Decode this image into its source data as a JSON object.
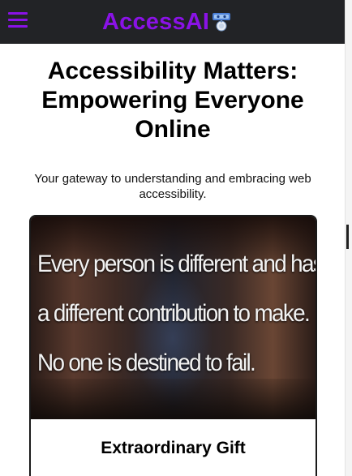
{
  "header": {
    "menu_icon": "hamburger-menu-icon",
    "brand_name": "AccessAI",
    "brand_icon": "robot-icon",
    "accent_color": "#8a12e6",
    "background_color": "#222326"
  },
  "main": {
    "title": "Accessibility Matters: Empowering Everyone Online",
    "subtitle": "Your gateway to understanding and embracing web accessibility."
  },
  "card": {
    "image_quote_lines": [
      "Every person is different and has",
      "a different contribution to make.",
      "No one is destined to fail."
    ],
    "title": "Extraordinary Gift"
  }
}
